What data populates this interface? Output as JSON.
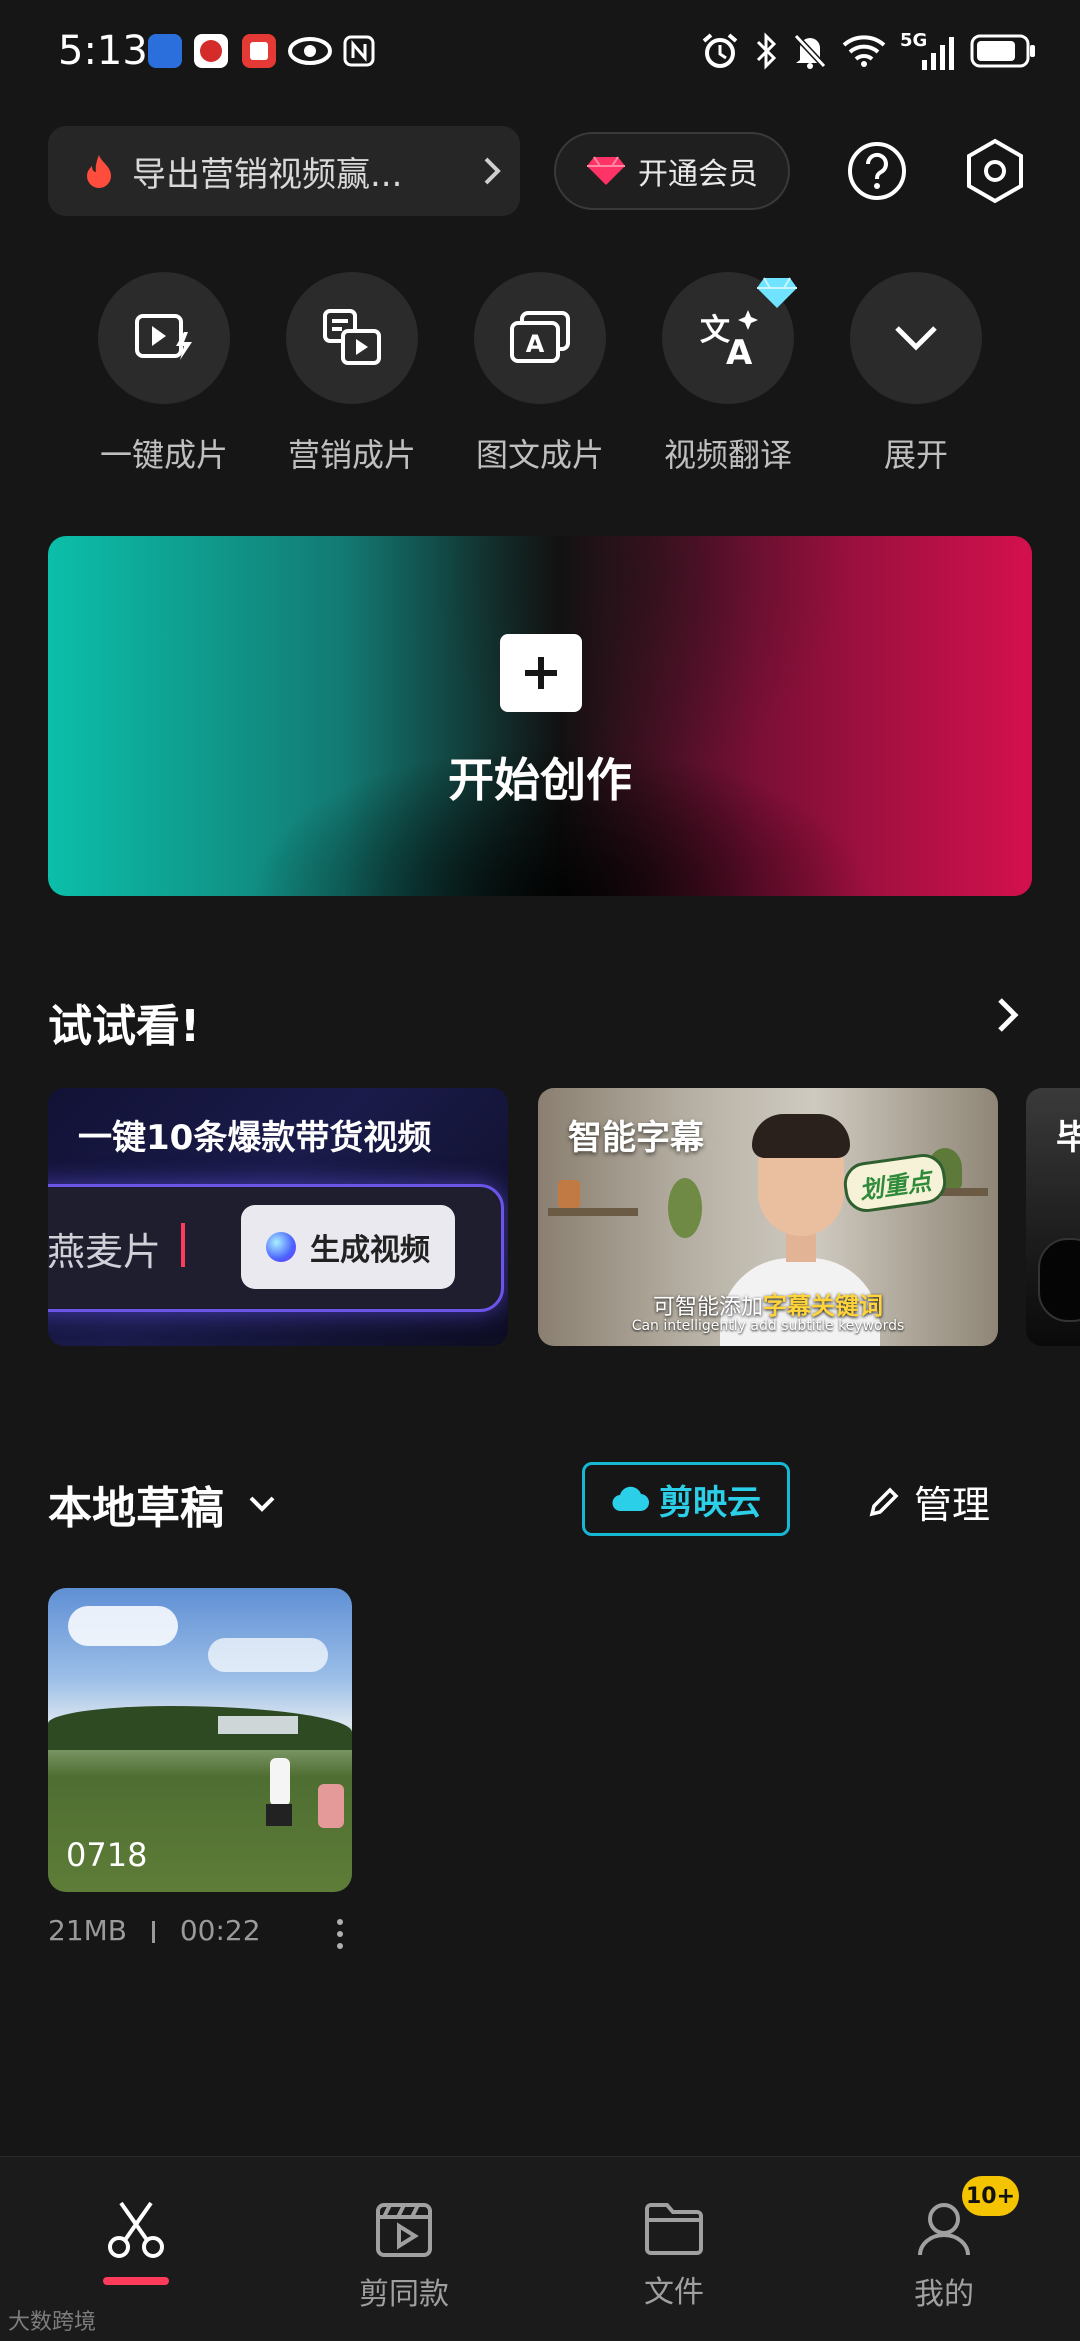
{
  "status_bar": {
    "time": "5:13",
    "network": "5G"
  },
  "top_bar": {
    "promo_text": "导出营销视频赢...",
    "vip_label": "开通会员"
  },
  "quick_tools": [
    {
      "label": "一键成片",
      "icon": "play-lightning-icon"
    },
    {
      "label": "营销成片",
      "icon": "marketing-video-icon"
    },
    {
      "label": "图文成片",
      "icon": "image-text-video-icon"
    },
    {
      "label": "视频翻译",
      "icon": "translate-icon"
    },
    {
      "label": "展开",
      "icon": "chevron-down-icon"
    }
  ],
  "create_banner": {
    "label": "开始创作"
  },
  "try_section": {
    "title": "试试看!",
    "cards": [
      {
        "title": "一键10条爆款带货视频",
        "input_text": "燕麦片",
        "button_label": "生成视频"
      },
      {
        "title": "智能字幕",
        "subtitle_cn_prefix": "可智能添加",
        "subtitle_cn_highlight": "字幕关键词",
        "subtitle_en": "Can intelligently add subtitle keywords",
        "sticker_text": "划重点"
      },
      {
        "title": "毕"
      }
    ]
  },
  "drafts": {
    "title": "本地草稿",
    "cloud_label": "剪映云",
    "manage_label": "管理",
    "items": [
      {
        "name": "0718",
        "size": "21MB",
        "duration": "00:22"
      }
    ]
  },
  "bottom_nav": {
    "items": [
      {
        "label": "",
        "icon": "scissors-icon",
        "active": true
      },
      {
        "label": "剪同款",
        "icon": "template-clapper-icon"
      },
      {
        "label": "文件",
        "icon": "folder-icon"
      },
      {
        "label": "我的",
        "icon": "profile-icon"
      }
    ],
    "badge": "10+"
  },
  "watermark": "大数跨境",
  "colors": {
    "accent_cyan": "#17b8d4",
    "active_underline": "#ff3b5c",
    "badge_yellow": "#f5c400",
    "background": "#161616"
  }
}
